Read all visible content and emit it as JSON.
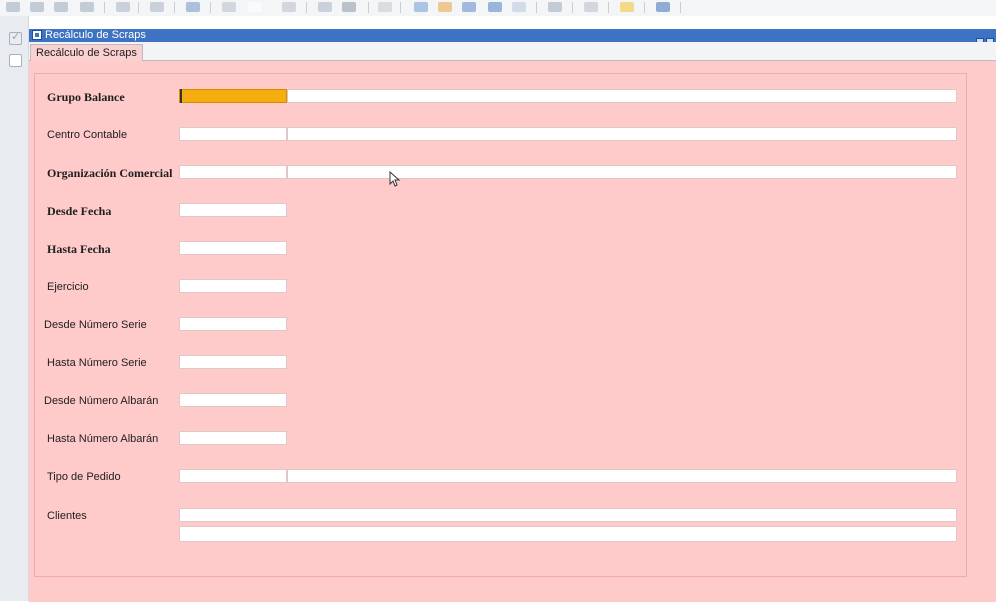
{
  "window": {
    "title": "Recálculo de Scraps"
  },
  "tab": {
    "label": "Recálculo de Scraps"
  },
  "form": {
    "fields": [
      {
        "label": "Grupo Balance",
        "bold": true
      },
      {
        "label": "Centro Contable",
        "bold": false
      },
      {
        "label": "Organización Comercial",
        "bold": true
      },
      {
        "label": "Desde Fecha",
        "bold": true
      },
      {
        "label": "Hasta Fecha",
        "bold": true
      },
      {
        "label": "Ejercicio",
        "bold": false
      },
      {
        "label": "Desde Número Serie",
        "bold": false
      },
      {
        "label": "Hasta Número Serie",
        "bold": false
      },
      {
        "label": "Desde Número Albarán",
        "bold": false
      },
      {
        "label": "Hasta Número Albarán",
        "bold": false
      },
      {
        "label": "Tipo de Pedido",
        "bold": false
      },
      {
        "label": "Clientes",
        "bold": false
      }
    ]
  },
  "colors": {
    "title_bar": "#3e73c4",
    "panel_bg": "#fecaca",
    "required_field": "#f6ad0e"
  },
  "toolbar": {
    "icons": [
      "first-icon",
      "prev-icon",
      "next-icon",
      "last-icon",
      "refresh-icon",
      "print-icon",
      "save-icon",
      "delete-icon",
      "blank-icon",
      "new-icon",
      "copy-icon",
      "paste-icon",
      "filter-icon",
      "search-icon",
      "edit-icon",
      "link-icon",
      "export-icon",
      "zoom-icon",
      "report-icon",
      "tools-icon",
      "favorite-icon",
      "help-icon"
    ]
  }
}
